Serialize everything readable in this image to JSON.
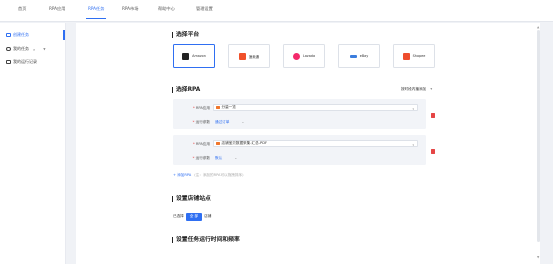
{
  "nav": {
    "tabs": [
      {
        "label": "首页"
      },
      {
        "label": "RPA应用"
      },
      {
        "label": "RPA任务"
      },
      {
        "label": "RPA市场"
      },
      {
        "label": "帮助中心"
      },
      {
        "label": "管理设置"
      }
    ],
    "active_index": 2
  },
  "sidebar": {
    "items": [
      {
        "label": "创建任务",
        "icon": "doc-icon"
      },
      {
        "label": "我的任务",
        "icon": "person-icon"
      },
      {
        "label": "我的运行记录",
        "icon": "list-icon"
      }
    ],
    "active_index": 0
  },
  "sections": {
    "platform": "选择平台",
    "rpa": "选择RPA",
    "store": "设置店铺站点",
    "schedule": "设置任务运行时间和频率"
  },
  "platforms": [
    {
      "label": "Amazon",
      "color": "#222222"
    },
    {
      "label": "速卖通",
      "color": "#f0502a"
    },
    {
      "label": "Lazada",
      "color": "#f4296b"
    },
    {
      "label": "eBay",
      "color": "#3b7ddd"
    },
    {
      "label": "Shopee",
      "color": "#ee4d2d"
    }
  ],
  "rpa": {
    "add_more": "按时段内播添加",
    "rows": [
      {
        "app_label": "RPA应用",
        "app_value": "分量一览",
        "type_label": "运行参数",
        "type_value": "通过订单"
      },
      {
        "app_label": "RPA应用",
        "app_value": "店铺宝贝数据采集-汇总-PDF",
        "type_label": "运行参数",
        "type_value": "默认"
      }
    ],
    "add_button": "添加RPA",
    "add_hint": "(注：添加的RPA可以拖拽排序)"
  },
  "store": {
    "prefix": "已选择",
    "button": "全 部",
    "suffix": "店铺"
  },
  "colors": {
    "accent": "#2f6ff2",
    "danger": "#e54545"
  }
}
